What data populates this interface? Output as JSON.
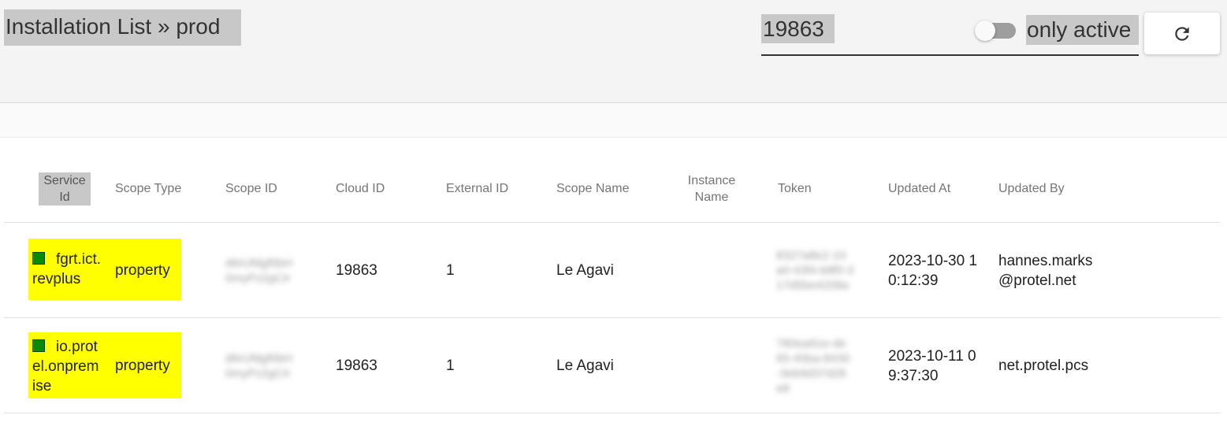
{
  "header": {
    "title": "Installation List » prod",
    "search_value": "19863",
    "toggle_label": "only active",
    "toggle_on": false
  },
  "table": {
    "columns": [
      "Service Id",
      "Scope Type",
      "Scope ID",
      "Cloud ID",
      "External ID",
      "Scope Name",
      "Instance Name",
      "Token",
      "Updated At",
      "Updated By"
    ],
    "rows": [
      {
        "service_id_1": "fgrt.ict.",
        "service_id_2": "revplus",
        "scope_type": "property",
        "scope_id_1": "d6rUfdgf0bH",
        "scope_id_2": "0myPz2gCIr",
        "cloud_id": "19863",
        "external_id": "1",
        "scope_name": "Le Agavi",
        "instance_name": "",
        "token_1": "8327a8e2-10",
        "token_2": "a0-43f4-b8f0-3",
        "token_3": "17d5be4208a",
        "updated_at_1": "2023-10-30 1",
        "updated_at_2": "0:12:39",
        "updated_by_1": "hannes.marks",
        "updated_by_2": "@protel.net",
        "status_color": "#0a8a0a"
      },
      {
        "service_id_1": "io.prot",
        "service_id_2": "el.onprem",
        "service_id_3": "ise",
        "scope_type": "property",
        "scope_id_1": "d6rUfdgf0bH",
        "scope_id_2": "0myPz2gCIr",
        "cloud_id": "19863",
        "external_id": "1",
        "scope_name": "Le Agavi",
        "instance_name": "",
        "token_1": "780ea91e-de",
        "token_2": "65-45ba-8430",
        "token_3": "-3eb9d37d28",
        "token_4": "e8",
        "updated_at_1": "2023-10-11 0",
        "updated_at_2": "9:37:30",
        "updated_by_1": "net.protel.pcs",
        "status_color": "#0a8a0a"
      }
    ]
  },
  "colors": {
    "highlight_yellow": "#ffff00",
    "status_green": "#0a8a0a",
    "header_bg": "#f4f4f4",
    "selection_gray": "#c8c8c8"
  }
}
